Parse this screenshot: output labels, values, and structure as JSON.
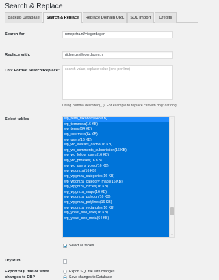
{
  "page_title": "Search & Replace",
  "tabs": [
    {
      "label": "Backup Database"
    },
    {
      "label": "Search & Replace"
    },
    {
      "label": "Replace Domain URL"
    },
    {
      "label": "SQL Import"
    },
    {
      "label": "Credits"
    }
  ],
  "search": {
    "label": "Search for:",
    "value": "renepetra.nl/vilegerdagen"
  },
  "replace": {
    "label": "Replace with:",
    "value": "rijdsergsvillegerdagen.nl"
  },
  "csv": {
    "label": "CSV Format Search/Replace:",
    "placeholder": "search value, replace value (one per line)",
    "hint": "Using comma delimited( , ). For example to replace cat with dog: cat,dog"
  },
  "tables": {
    "label": "Select tables",
    "options": [
      "wp_term_taxonomy(48 KB)",
      "wp_termmeta(16 KB)",
      "wp_terms(64 KB)",
      "wp_usermeta(64 KB)",
      "wp_users(16 KB)",
      "wp_wc_avatars_cache(16 KB)",
      "wp_wc_comments_subscription(16 KB)",
      "wp_wc_follow_users(16 KB)",
      "wp_wc_phrases(16 KB)",
      "wp_wc_users_voted(16 KB)",
      "wp_wpgmza(16 KB)",
      "wp_wpgmza_categories(16 KB)",
      "wp_wpgmza_category_maps(16 KB)",
      "wp_wpgmza_circles(16 KB)",
      "wp_wpgmza_maps(16 KB)",
      "wp_wpgmza_polygon(16 KB)",
      "wp_wpgmza_polylines(16 KB)",
      "wp_wpgmza_rectangles(16 KB)",
      "wp_yoast_seo_links(16 KB)",
      "wp_yoast_seo_meta(64 KB)"
    ],
    "select_all_label": "Select all tables"
  },
  "dry_run": {
    "label": "Dry Run"
  },
  "export": {
    "label_line1": "Export SQL file or write",
    "label_line2": "changes to DB?",
    "option_export": "Export SQL file with changes",
    "option_save": "Save changes to Database"
  },
  "colors": {
    "selection": "#0074d9",
    "focus_row": "#1e8cff",
    "accent": "#1e8cbe"
  }
}
